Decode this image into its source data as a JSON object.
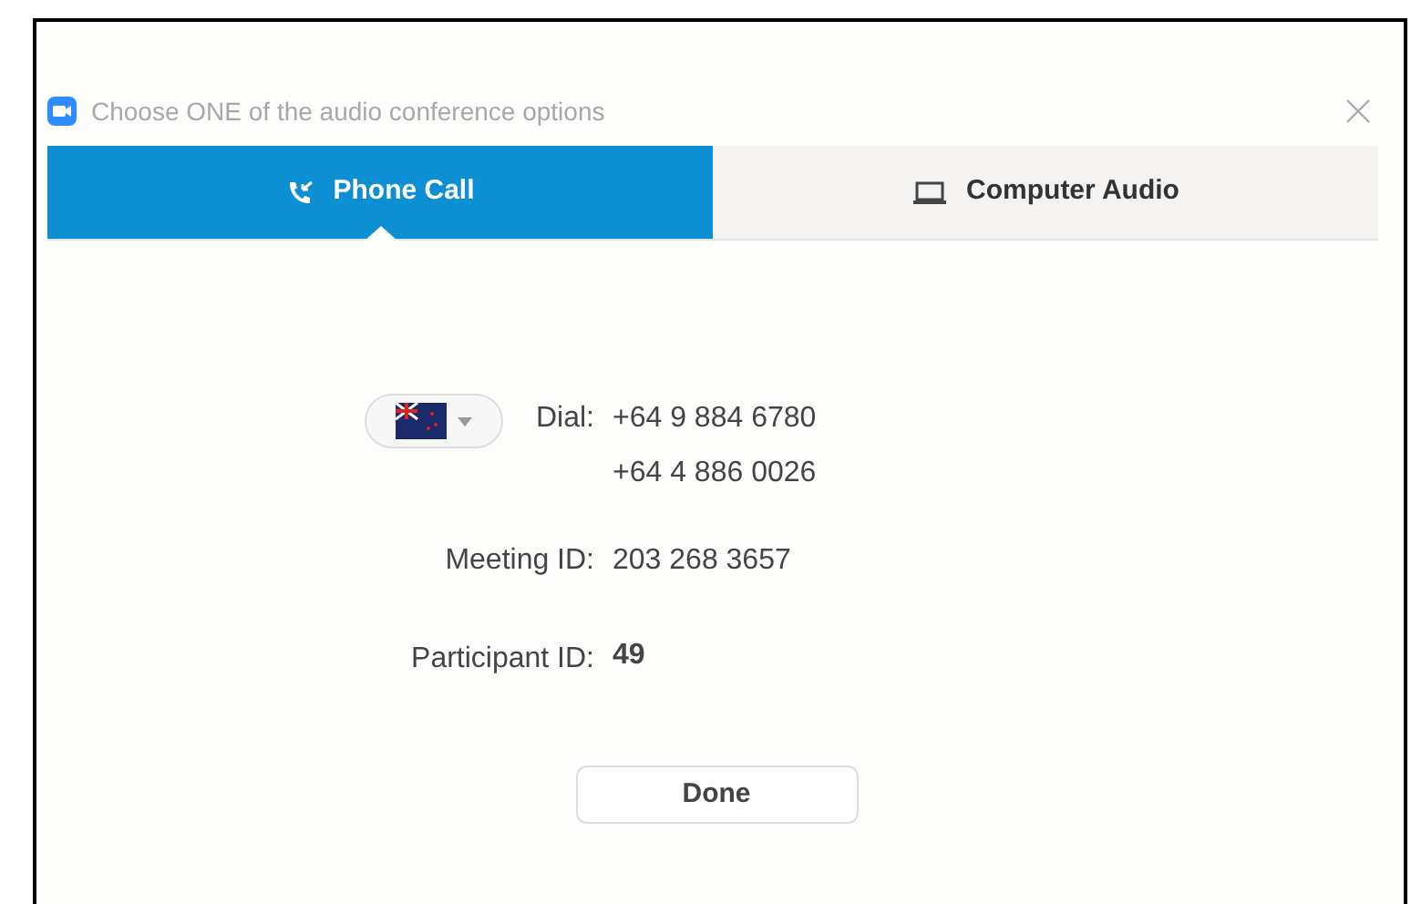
{
  "window": {
    "title": "Choose ONE of the audio conference options"
  },
  "tabs": [
    {
      "label": "Phone Call",
      "kind": "phone",
      "selected": true
    },
    {
      "label": "Computer Audio",
      "kind": "computer",
      "selected": false
    }
  ],
  "dial": {
    "label": "Dial:",
    "numbers": [
      "+64 9 884 6780",
      "+64 4 886 0026"
    ]
  },
  "meeting_id": {
    "label": "Meeting ID:",
    "value": "203 268 3657"
  },
  "participant_id": {
    "label": "Participant ID:",
    "value": "49"
  },
  "done_button": "Done"
}
